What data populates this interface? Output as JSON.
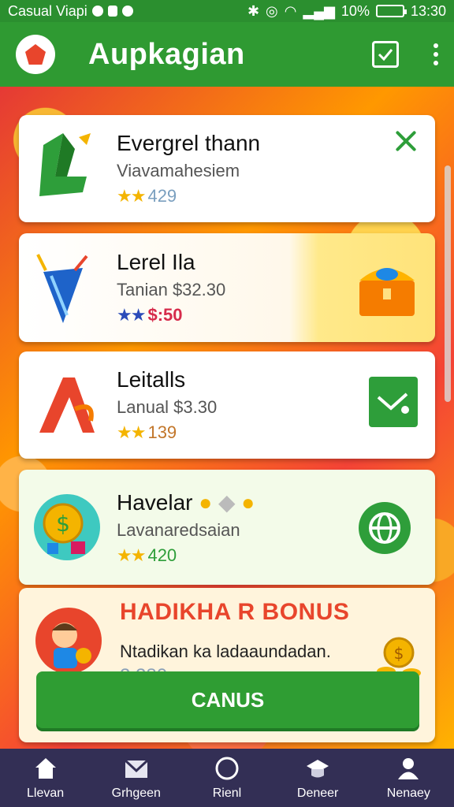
{
  "statusbar": {
    "app_name": "Casual Viapi",
    "battery_percent": "10%",
    "time": "13:30"
  },
  "appbar": {
    "title": "Aupkagian"
  },
  "cards": [
    {
      "title": "Evergrel thann",
      "subtitle": "Viavamahesiem",
      "rating": "429",
      "stars": 2,
      "star_color": "#f4b400"
    },
    {
      "title": "Lerel Ila",
      "subtitle": "Tanian $32.30",
      "rating": "$:50",
      "stars": 2,
      "star_color": "#2b4bb9",
      "rating_color": "#d62b4b"
    },
    {
      "title": "Leitalls",
      "subtitle": "Lanual $3.30",
      "rating": "139",
      "stars": 2,
      "star_color": "#f4b400"
    },
    {
      "title": "Havelar",
      "subtitle": "Lavanaredsaian",
      "rating": "420",
      "stars": 2,
      "star_color": "#f4b400",
      "rating_color": "#2e9e3a"
    }
  ],
  "bonus": {
    "title": "HADIKHA R BONUS",
    "text": "Ntadikan ka ladaaundadan.",
    "count": "2 280",
    "cta_label": "CANUS"
  },
  "nav": [
    {
      "label": "Llevan",
      "icon": "home-icon"
    },
    {
      "label": "Grhgeen",
      "icon": "mail-icon"
    },
    {
      "label": "Rienl",
      "icon": "circle-icon"
    },
    {
      "label": "Deneer",
      "icon": "hat-icon"
    },
    {
      "label": "Nenaey",
      "icon": "person-icon"
    }
  ],
  "colors": {
    "primary_green": "#2f9a32",
    "accent_red": "#e8452c",
    "nav_bg": "#332f55",
    "star_gold": "#f4b400"
  }
}
